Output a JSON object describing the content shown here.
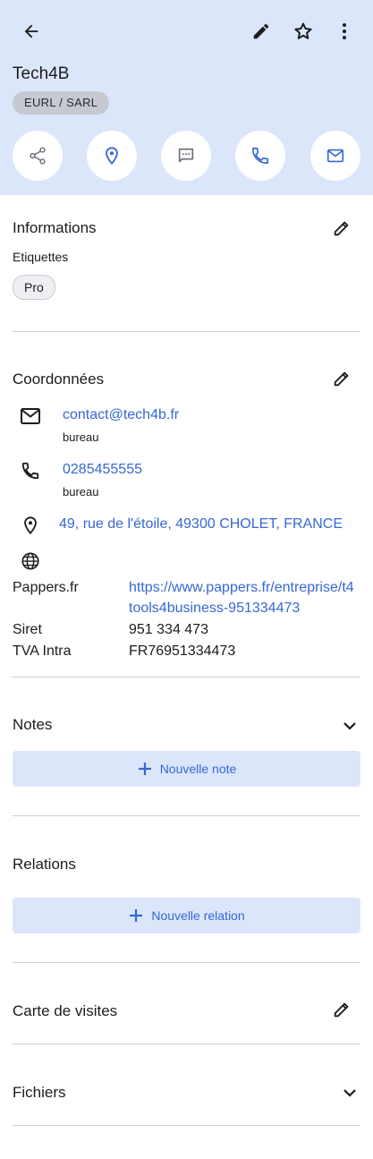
{
  "header": {
    "title": "Tech4B",
    "legal_form": "EURL / SARL",
    "icons": [
      "arrow-back-icon",
      "pencil-icon",
      "star-outline-icon",
      "more-vertical-icon"
    ],
    "actions": [
      "share-icon",
      "location-pin-icon",
      "message-icon",
      "phone-icon",
      "mail-icon"
    ]
  },
  "informations": {
    "title": "Informations",
    "tags_label": "Etiquettes",
    "tags": [
      "Pro"
    ]
  },
  "coordonnees": {
    "title": "Coordonnées",
    "email": "contact@tech4b.fr",
    "email_type": "bureau",
    "phone": "0285455555",
    "phone_type": "bureau",
    "address": "49, rue de l'étoile, 49300 CHOLET, FRANCE",
    "pappers_label": "Pappers.fr",
    "pappers_url_line1": "https://www.pappers.fr/entreprise/t4",
    "pappers_url_line2": "tools4business-951334473",
    "siret_label": "Siret",
    "siret_value": "951 334 473",
    "tva_label": "TVA Intra",
    "tva_value": "FR76951334473"
  },
  "notes": {
    "title": "Notes",
    "add_label": "Nouvelle note"
  },
  "relations": {
    "title": "Relations",
    "add_label": "Nouvelle relation"
  },
  "carte": {
    "title": "Carte de visites"
  },
  "fichiers": {
    "title": "Fichiers"
  },
  "colors": {
    "accent": "#3568d4",
    "header_bg": "#dbe6fb",
    "chip_bg": "#c6c9d0",
    "text": "#1c1c1e"
  }
}
